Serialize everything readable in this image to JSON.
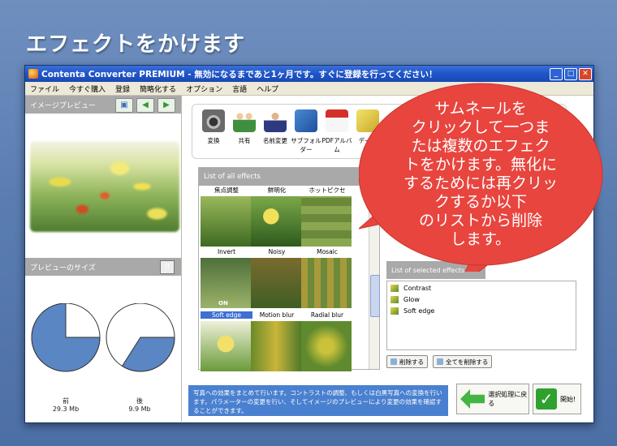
{
  "page": {
    "headline": "エフェクトをかけます"
  },
  "window": {
    "title": "Contenta Converter PREMIUM - 無効になるまであと1ヶ月です。すぐに登録を行ってください！",
    "controls": {
      "minimize": "_",
      "maximize": "□",
      "close": "✕"
    }
  },
  "menu": [
    "ファイル",
    "今すぐ購入",
    "登録",
    "簡略化する",
    "オプション",
    "言語",
    "ヘルプ"
  ],
  "left_panel": {
    "preview_header": "イメージプレビュー",
    "size_header": "プレビューのサイズ",
    "before_label": "前",
    "before_size": "29.3 Mb",
    "after_label": "後",
    "after_size": "9.9 Mb",
    "pause_label": "II"
  },
  "toolbar": [
    "変換",
    "共有",
    "名前変更",
    "サブフォルダー",
    "PDFアルバム",
    "データ"
  ],
  "effects": {
    "header": "List of all effects",
    "top_labels": [
      "焦点調整",
      "鮮明化",
      "ホットピクセ"
    ],
    "middle_labels": [
      "Invert",
      "Noisy",
      "Mosaic"
    ],
    "bottom_labels": [
      "Soft edge",
      "Motion blur",
      "Radial blur"
    ],
    "on_badge": "ON"
  },
  "selected_effects": {
    "header": "List of selected effects",
    "items": [
      "Contrast",
      "Glow",
      "Soft edge"
    ],
    "delete_button": "削除する",
    "delete_all_button": "全てを削除する"
  },
  "description": "写真への効果をまとめて行います。コントラストの調整、もしくは白黒写真への変換を行います。パラメーターの変更を行い、そしてイメージのプレビューにより変更の効果を確認することができます。",
  "actions": {
    "back": "選択処理に戻る",
    "start": "開始!"
  },
  "callout": [
    "サムネールを",
    "クリックして一つま",
    "たは複数のエフェク",
    "トをかけます。無化に",
    "するためには再クリッ",
    "クするか以下",
    "のリストから削除",
    "します。"
  ],
  "colors": {
    "callout": "#e8453f",
    "accent": "#3e6fd1",
    "pie": "#5b86c4"
  },
  "preview_sizes": {
    "before_fraction": 0.75,
    "after_fraction": 0.34
  }
}
